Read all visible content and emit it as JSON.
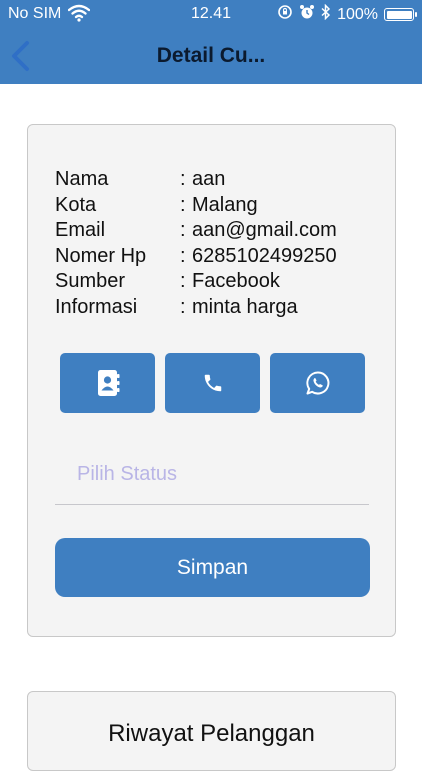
{
  "status_bar": {
    "carrier": "No SIM",
    "time": "12.41",
    "battery": "100%"
  },
  "nav": {
    "title": "Detail Cu..."
  },
  "customer": {
    "rows": [
      {
        "label": "Nama",
        "value": "aan"
      },
      {
        "label": "Kota",
        "value": "Malang"
      },
      {
        "label": "Email",
        "value": "aan@gmail.com"
      },
      {
        "label": "Nomer Hp",
        "value": "6285102499250"
      },
      {
        "label": "Sumber",
        "value": "Facebook"
      },
      {
        "label": "Informasi",
        "value": "minta harga"
      }
    ],
    "separator": ":"
  },
  "actions": [
    {
      "icon": "contact-book-icon"
    },
    {
      "icon": "phone-icon"
    },
    {
      "icon": "whatsapp-icon"
    }
  ],
  "status_select": {
    "placeholder": "Pilih Status"
  },
  "save": {
    "label": "Simpan"
  },
  "history": {
    "title": "Riwayat Pelanggan"
  },
  "colors": {
    "primary": "#3f7fc1",
    "card_bg": "#f4f4f4",
    "placeholder": "#b9b5e6",
    "nav_title": "#0b1a2e"
  }
}
